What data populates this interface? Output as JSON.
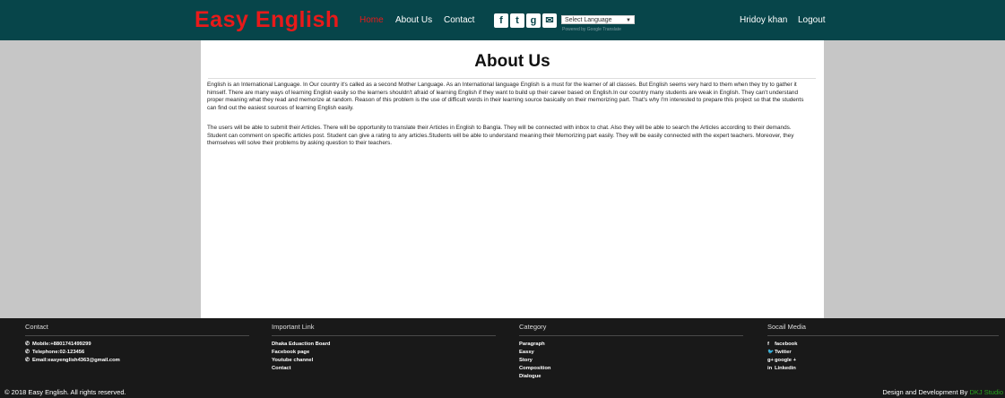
{
  "header": {
    "brand": "Easy English",
    "nav": [
      "Home",
      "About Us",
      "Contact"
    ],
    "active_nav": "Home",
    "social_icons": [
      "facebook-icon",
      "twitter-icon",
      "google-plus-icon",
      "mail-icon"
    ],
    "language_select": "Select Language",
    "powered_by": "Powered by Google Translate",
    "user_name": "Hridoy khan",
    "logout": "Logout"
  },
  "main": {
    "title": "About Us",
    "paragraphs": [
      "English is an International Language. In Our country it's called as a second Mother Language. As an International language English is a must for the learner of all classes. But English seems very hard to them when they try to gather it himself. There are many ways of learning English easily so the learners shouldn't afraid of learning English if they want to build up their career based on English.In our country many students are weak in English. They can't understand proper meaning what they read and memorize at random. Reason of this problem is the use of difficult words in their learning source basically on their memorizing part. That's why I'm interested to prepare this project so that the students can find out the easiest sources of learning English easily.",
      "The users will be able to submit their Articles. There will be opportunity to translate their Articles in English to Bangla. They will be connected with inbox to chat. Also they will be able to search the Articles according to their demands. Student can comment on specific articles post. Student can give a rating to any articles.Students will be able to understand meaning their Memorizing part easily. They will be easily connected with the expert teachers. Moreover, they themselves will solve their problems by asking question to their teachers."
    ]
  },
  "footer": {
    "contact": {
      "title": "Contact",
      "items": [
        "Mobile:+8801741499299",
        "Telephone:02-123456",
        "Email:easyenglish4363@gmail.com"
      ]
    },
    "important_link": {
      "title": "Important Link",
      "items": [
        "Dhaka Eduaction Board",
        "Facebook page",
        "Youtube channel",
        "Contact"
      ]
    },
    "category": {
      "title": "Category",
      "items": [
        "Paragraph",
        "Eassy",
        "Story",
        "Composition",
        "Dialogue"
      ]
    },
    "social_media": {
      "title": "Socail Media",
      "items": [
        "facebook",
        "Twitter",
        "google +",
        "Linkedin"
      ],
      "icons": [
        "f",
        "🐦",
        "g+",
        "in"
      ]
    },
    "copyright": "© 2018 Easy English. All rights reserved.",
    "design_text": "Design and Development By",
    "design_studio": "DKJ Studio"
  },
  "colors": {
    "header_bg": "#07454a",
    "brand": "#e81a1a",
    "footer_bg": "#191919",
    "page_bg": "#c6c6c6",
    "studio": "#29a31e"
  }
}
